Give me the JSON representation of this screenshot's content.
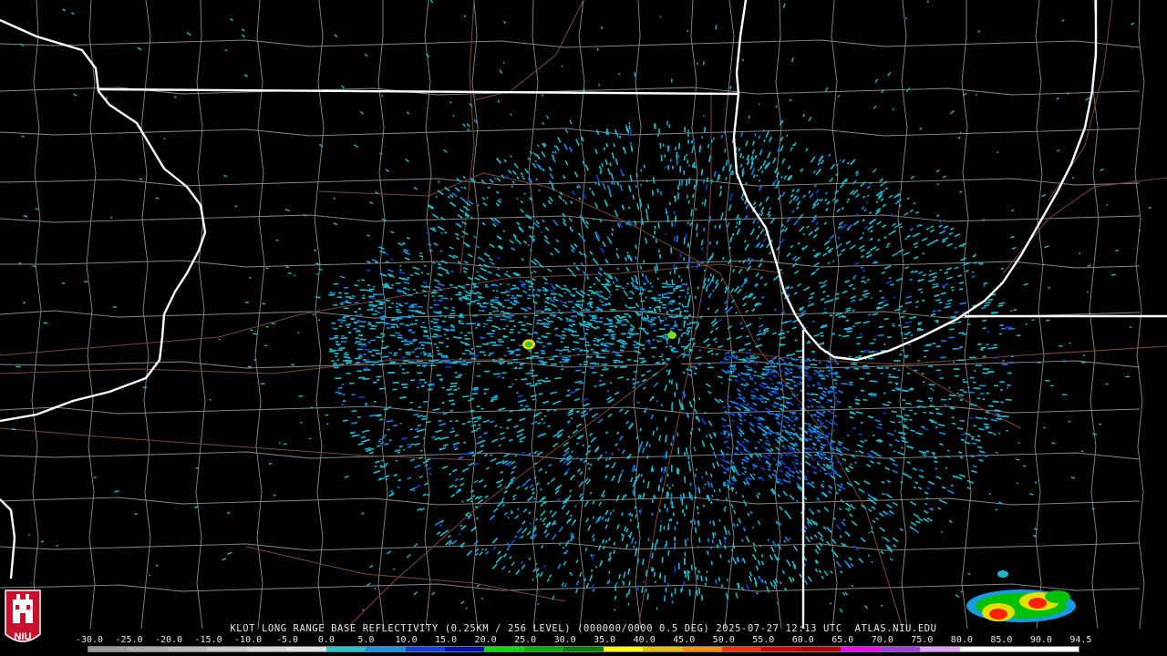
{
  "caption": "KLOT LONG RANGE BASE REFLECTIVITY (0.25KM / 256 LEVEL) (000000/0000 0.5 DEG) 2025-07-27 12:13 UTC  ATLAS.NIU.EDU",
  "logo": {
    "text": "NIU"
  },
  "scale": {
    "labels": [
      "-30.0",
      "-25.0",
      "-20.0",
      "-15.0",
      "-10.0",
      "-5.0",
      "0.0",
      "5.0",
      "10.0",
      "15.0",
      "20.0",
      "25.0",
      "30.0",
      "35.0",
      "40.0",
      "45.0",
      "50.0",
      "55.0",
      "60.0",
      "65.0",
      "70.0",
      "75.0",
      "80.0",
      "85.0",
      "90.0",
      "94.5"
    ],
    "colors": [
      "#9a9a9a",
      "#a8a8a8",
      "#b8b8b8",
      "#c8c8c8",
      "#d6d6d6",
      "#e0e0e0",
      "#26c6c6",
      "#1e90e6",
      "#1040e0",
      "#0010b0",
      "#00e000",
      "#00b000",
      "#008000",
      "#ffff00",
      "#e8c000",
      "#ff9000",
      "#ff3000",
      "#d00000",
      "#b00000",
      "#ff00ff",
      "#a040e0",
      "#e0a0ff",
      "#ffffff",
      "#ffffff",
      "#ffffff"
    ]
  },
  "map": {
    "colors": {
      "state": "#ffffff",
      "county": "#8a8a8a",
      "road": "#7a4a30",
      "low": "#20b8c8",
      "mid": "#1a80e0",
      "deep": "#1040d0",
      "core": "#e0e000",
      "hot": "#ff2000"
    }
  }
}
